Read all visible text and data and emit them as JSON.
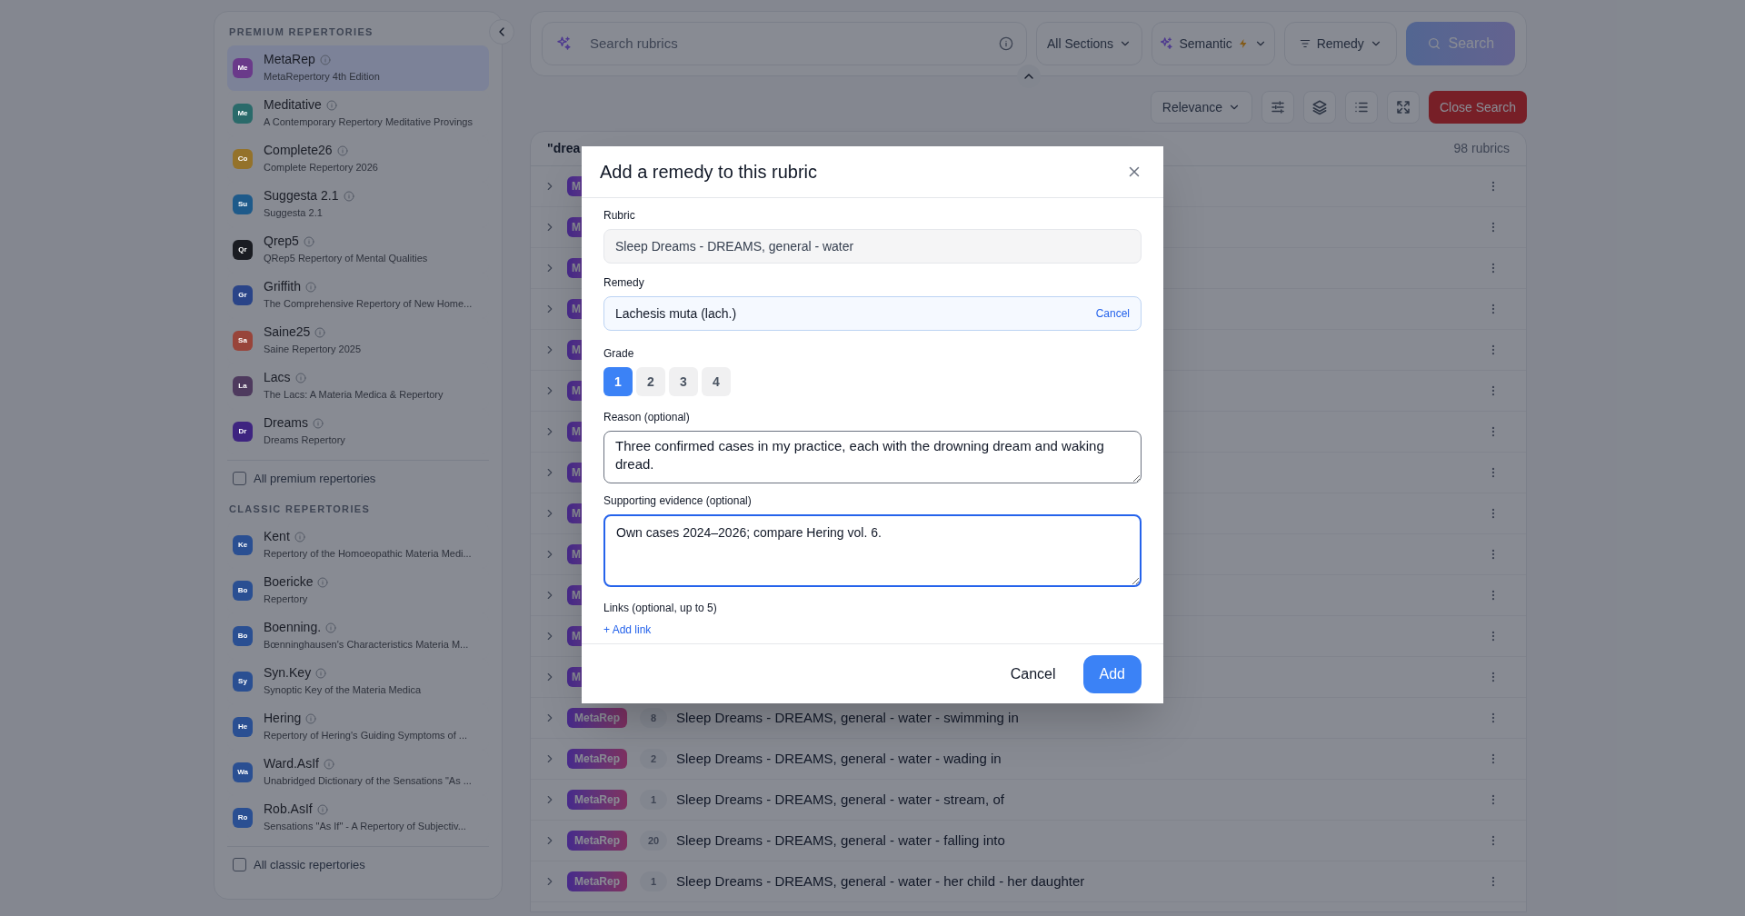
{
  "sidebar": {
    "sections": [
      {
        "heading": "PREMIUM REPERTORIES",
        "items": [
          {
            "abbr": "Me",
            "name": "MetaRep",
            "subtitle": "MetaRepertory 4th Edition",
            "color": "#6a3a8a",
            "selected": true
          },
          {
            "abbr": "Me",
            "name": "Meditative",
            "subtitle": "A Contemporary Repertory Meditative Provings",
            "color": "#2a6a6a",
            "selected": false
          },
          {
            "abbr": "Co",
            "name": "Complete26",
            "subtitle": "Complete Repertory 2026",
            "color": "#94722a",
            "selected": false
          },
          {
            "abbr": "Su",
            "name": "Suggesta 2.1",
            "subtitle": "Suggesta 2.1",
            "color": "#1e5a8a",
            "selected": false
          },
          {
            "abbr": "Qr",
            "name": "Qrep5",
            "subtitle": "QRep5 Repertory of Mental Qualities",
            "color": "#1a1c22",
            "selected": false
          },
          {
            "abbr": "Gr",
            "name": "Griffith",
            "subtitle": "The Comprehensive Repertory of New Home...",
            "color": "#2a4488",
            "selected": false
          },
          {
            "abbr": "Sa",
            "name": "Saine25",
            "subtitle": "Saine Repertory 2025",
            "color": "#98443a",
            "selected": false
          },
          {
            "abbr": "La",
            "name": "Lacs",
            "subtitle": "The Lacs: A Materia Medica & Repertory",
            "color": "#4e3a5e",
            "selected": false
          },
          {
            "abbr": "Dr",
            "name": "Dreams",
            "subtitle": "Dreams Repertory",
            "color": "#3e2480",
            "selected": false
          }
        ],
        "all_label": "All premium repertories",
        "all_checked": false
      },
      {
        "heading": "CLASSIC REPERTORIES",
        "items": [
          {
            "abbr": "Ke",
            "name": "Kent",
            "subtitle": "Repertory of the Homoeopathic Materia Medi...",
            "color": "#2a4f92",
            "selected": false
          },
          {
            "abbr": "Bo",
            "name": "Boericke",
            "subtitle": "Repertory",
            "color": "#2a4f92",
            "selected": false
          },
          {
            "abbr": "Bo",
            "name": "Boenning.",
            "subtitle": "Bœnninghausen's Characteristics Materia M...",
            "color": "#2a4f92",
            "selected": false
          },
          {
            "abbr": "Sy",
            "name": "Syn.Key",
            "subtitle": "Synoptic Key of the Materia Medica",
            "color": "#2a4f92",
            "selected": false
          },
          {
            "abbr": "He",
            "name": "Hering",
            "subtitle": "Repertory of Hering's Guiding Symptoms of ...",
            "color": "#2a4f92",
            "selected": false
          },
          {
            "abbr": "Wa",
            "name": "Ward.AsIf",
            "subtitle": "Unabridged Dictionary of the Sensations \"As ...",
            "color": "#2a4f92",
            "selected": false
          },
          {
            "abbr": "Ro",
            "name": "Rob.AsIf",
            "subtitle": "Sensations \"As If\" - A Repertory of Subjectiv...",
            "color": "#2a4f92",
            "selected": false
          }
        ],
        "all_label": "All classic repertories",
        "all_checked": false
      }
    ]
  },
  "search": {
    "placeholder": "Search rubrics",
    "sections": "All Sections",
    "mode": "Semantic",
    "filter": "Remedy",
    "button": "Search"
  },
  "toolbar": {
    "sort": "Relevance",
    "close": "Close Search"
  },
  "results": {
    "query": "\"drea",
    "count": "98 rubrics",
    "rows": [
      {
        "badge": "M"
      },
      {
        "badge": "M"
      },
      {
        "badge": "M"
      },
      {
        "badge": "M"
      },
      {
        "badge": "M"
      },
      {
        "badge": "M"
      },
      {
        "badge": "M"
      },
      {
        "badge": "M"
      },
      {
        "badge": "M"
      },
      {
        "badge": "M"
      },
      {
        "badge": "M"
      },
      {
        "badge": "M"
      },
      {
        "badge": "M"
      },
      {
        "badge": "MetaRep",
        "count": "8",
        "title": "Sleep Dreams - DREAMS, general - water - swimming in"
      },
      {
        "badge": "MetaRep",
        "count": "2",
        "title": "Sleep Dreams - DREAMS, general - water - wading in"
      },
      {
        "badge": "MetaRep",
        "count": "1",
        "title": "Sleep Dreams - DREAMS, general - water - stream, of"
      },
      {
        "badge": "MetaRep",
        "count": "20",
        "title": "Sleep Dreams - DREAMS, general - water - falling into"
      },
      {
        "badge": "MetaRep",
        "count": "1",
        "title": "Sleep Dreams - DREAMS, general - water - her child - her daughter"
      }
    ]
  },
  "dialog": {
    "title": "Add a remedy to this rubric",
    "rubric_label": "Rubric",
    "rubric_value": "Sleep Dreams - DREAMS, general - water",
    "remedy_label": "Remedy",
    "remedy_value": "Lachesis muta (lach.)",
    "remedy_cancel": "Cancel",
    "grade_label": "Grade",
    "grades": [
      {
        "label": "1",
        "selected": true
      },
      {
        "label": "2",
        "selected": false
      },
      {
        "label": "3",
        "selected": false
      },
      {
        "label": "4",
        "selected": false
      }
    ],
    "reason_label": "Reason (optional)",
    "reason_value": "Three confirmed cases in my practice, each with the drowning dream and waking dread.",
    "evidence_label": "Supporting evidence (optional)",
    "evidence_value": "Own cases 2024–2026; compare Hering vol. 6.",
    "evidence_focused": true,
    "links_label": "Links (optional, up to 5)",
    "add_link": "+ Add link",
    "cancel": "Cancel",
    "submit": "Add"
  }
}
